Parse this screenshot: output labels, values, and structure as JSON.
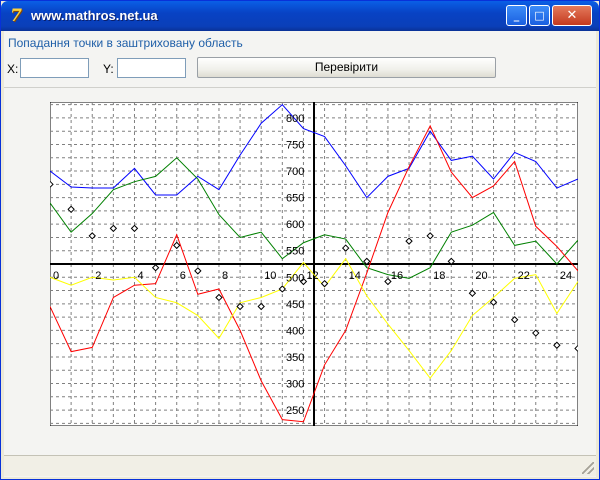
{
  "window": {
    "title": "www.mathros.net.ua",
    "app_icon": "7",
    "controls": {
      "minimize": "_",
      "maximize": "□",
      "close": "✕"
    }
  },
  "header": {
    "caption": "Попадання точки в заштриховану область",
    "x_label": "X:",
    "y_label": "Y:",
    "x_value": "",
    "y_value": "",
    "check_button": "Перевірити"
  },
  "chart_data": {
    "type": "line",
    "title": "",
    "xlabel": "",
    "ylabel": "",
    "xlim": [
      0,
      25
    ],
    "ylim": [
      220,
      830
    ],
    "x_axis_value": 525,
    "y_axis_position_x": 12.5,
    "x_ticks": [
      0,
      2,
      4,
      6,
      8,
      10,
      12,
      14,
      16,
      18,
      20,
      22,
      24
    ],
    "y_ticks": [
      250,
      300,
      350,
      400,
      450,
      500,
      550,
      600,
      650,
      700,
      750,
      800
    ],
    "grid": true,
    "colors": {
      "blue": "#0000ff",
      "green": "#008000",
      "red": "#ff0000",
      "yellow": "#ffff00",
      "points": "#000000"
    },
    "series": [
      {
        "color": "blue",
        "x": [
          0,
          1,
          2,
          3,
          4,
          5,
          6,
          7,
          8,
          9,
          10,
          11,
          12,
          13,
          14,
          15,
          16,
          17,
          18,
          19,
          20,
          21,
          22,
          23,
          24,
          25
        ],
        "values": [
          700,
          670,
          668,
          668,
          705,
          655,
          655,
          690,
          665,
          730,
          790,
          825,
          780,
          765,
          710,
          650,
          690,
          705,
          775,
          720,
          728,
          685,
          735,
          718,
          668,
          685
        ]
      },
      {
        "color": "green",
        "x": [
          0,
          1,
          2,
          3,
          4,
          5,
          6,
          7,
          8,
          9,
          10,
          11,
          12,
          13,
          14,
          15,
          16,
          17,
          18,
          19,
          20,
          21,
          22,
          23,
          24,
          25
        ],
        "values": [
          640,
          585,
          620,
          665,
          680,
          690,
          725,
          685,
          618,
          575,
          585,
          535,
          565,
          580,
          572,
          518,
          505,
          498,
          518,
          585,
          598,
          622,
          560,
          568,
          525,
          570
        ]
      },
      {
        "color": "red",
        "x": [
          0,
          1,
          2,
          3,
          4,
          5,
          6,
          7,
          8,
          9,
          10,
          11,
          12,
          13,
          14,
          15,
          16,
          17,
          18,
          19,
          20,
          21,
          22,
          23,
          24,
          25
        ],
        "values": [
          445,
          360,
          368,
          462,
          485,
          488,
          580,
          468,
          478,
          400,
          305,
          232,
          228,
          335,
          400,
          508,
          622,
          708,
          785,
          698,
          650,
          672,
          718,
          596,
          558,
          512
        ]
      },
      {
        "color": "yellow",
        "x": [
          0,
          1,
          2,
          3,
          4,
          5,
          6,
          7,
          8,
          9,
          10,
          11,
          12,
          13,
          14,
          15,
          16,
          17,
          18,
          19,
          20,
          21,
          22,
          23,
          24,
          25
        ],
        "values": [
          500,
          485,
          500,
          495,
          500,
          462,
          452,
          428,
          385,
          452,
          462,
          478,
          528,
          482,
          535,
          465,
          412,
          362,
          310,
          362,
          428,
          462,
          498,
          505,
          432,
          492
        ]
      },
      {
        "color": "points",
        "marker": "diamond",
        "x": [
          0,
          1,
          2,
          3,
          4,
          5,
          6,
          7,
          8,
          9,
          10,
          11,
          12,
          13,
          14,
          15,
          16,
          17,
          18,
          19,
          20,
          21,
          22,
          23,
          24,
          25
        ],
        "values": [
          675,
          628,
          578,
          592,
          592,
          518,
          560,
          512,
          462,
          445,
          445,
          478,
          492,
          488,
          555,
          530,
          492,
          568,
          578,
          530,
          470,
          453,
          420,
          395,
          372,
          366
        ]
      }
    ]
  }
}
